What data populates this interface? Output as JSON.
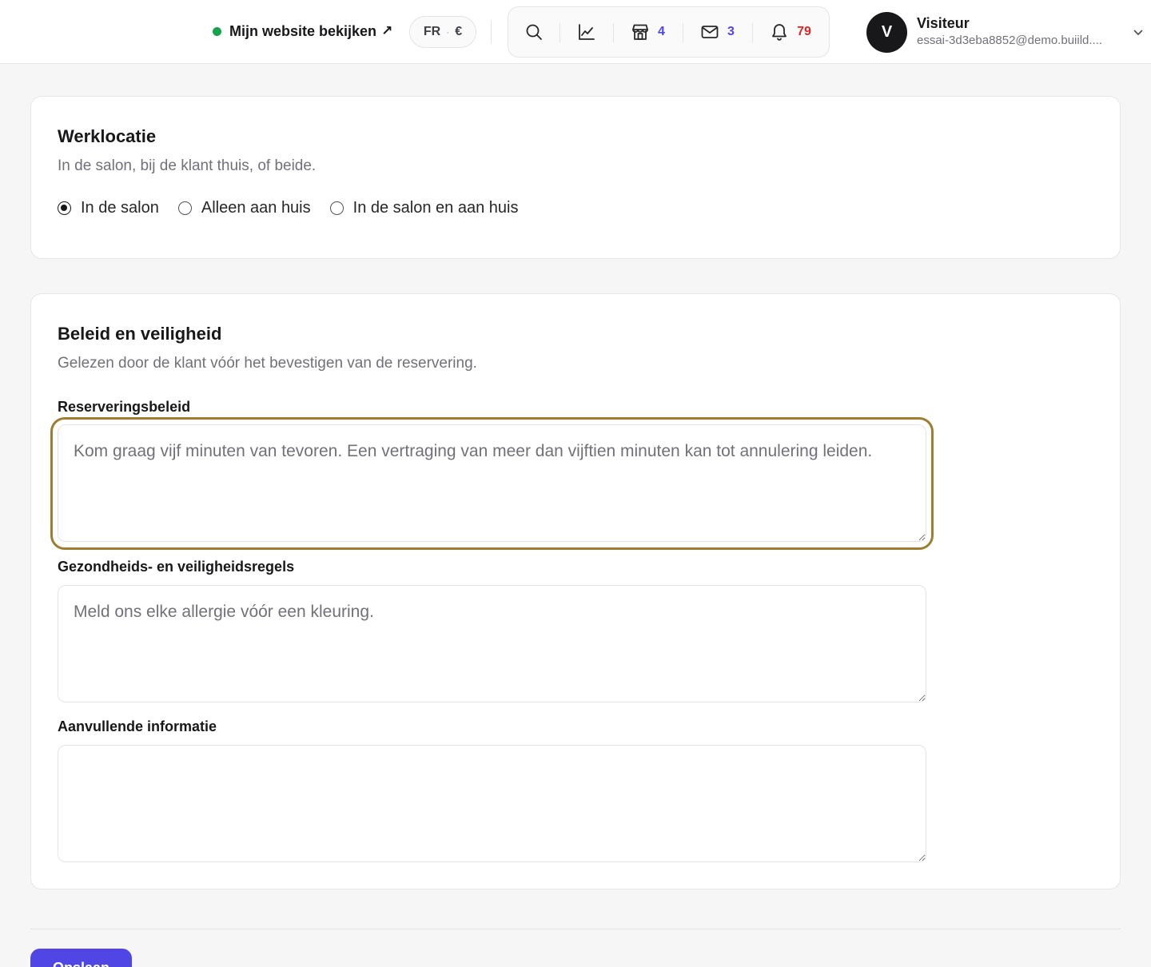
{
  "topbar": {
    "site_link": "Mijn website bekijken",
    "site_link_arrow": "↗",
    "lang": "FR",
    "lang_sep": "·",
    "currency": "€",
    "icons": {
      "search": "search-icon",
      "stats": "chart-icon",
      "shop": "store-icon",
      "mail": "mail-icon",
      "bell": "bell-icon"
    },
    "counts": {
      "shop": "4",
      "mail": "3",
      "bell": "79"
    },
    "colors": {
      "online": "#16a34a",
      "count_blue": "#4f46e5",
      "count_red": "#dc2626"
    },
    "user": {
      "initial": "V",
      "name": "Visiteur",
      "email": "essai-3d3eba8852@demo.buiild...."
    }
  },
  "work_location": {
    "title": "Werklocatie",
    "subtitle": "In de salon, bij de klant thuis, of beide.",
    "options": [
      {
        "label": "In de salon",
        "selected": true
      },
      {
        "label": "Alleen aan huis",
        "selected": false
      },
      {
        "label": "In de salon en aan huis",
        "selected": false
      }
    ]
  },
  "policy": {
    "title": "Beleid en veiligheid",
    "subtitle": "Gelezen door de klant vóór het bevestigen van de reservering.",
    "fields": [
      {
        "label": "Reserveringsbeleid",
        "placeholder": "Kom graag vijf minuten van tevoren. Een vertraging van meer dan vijftien minuten kan tot annulering leiden.",
        "focused": true
      },
      {
        "label": "Gezondheids- en veiligheidsregels",
        "placeholder": "Meld ons elke allergie vóór een kleuring.",
        "focused": false
      },
      {
        "label": "Aanvullende informatie",
        "placeholder": "",
        "focused": false
      }
    ],
    "focus_color": "#a07c2f"
  },
  "footer": {
    "save_label": "Opslaan",
    "save_color": "#4f46e5"
  }
}
